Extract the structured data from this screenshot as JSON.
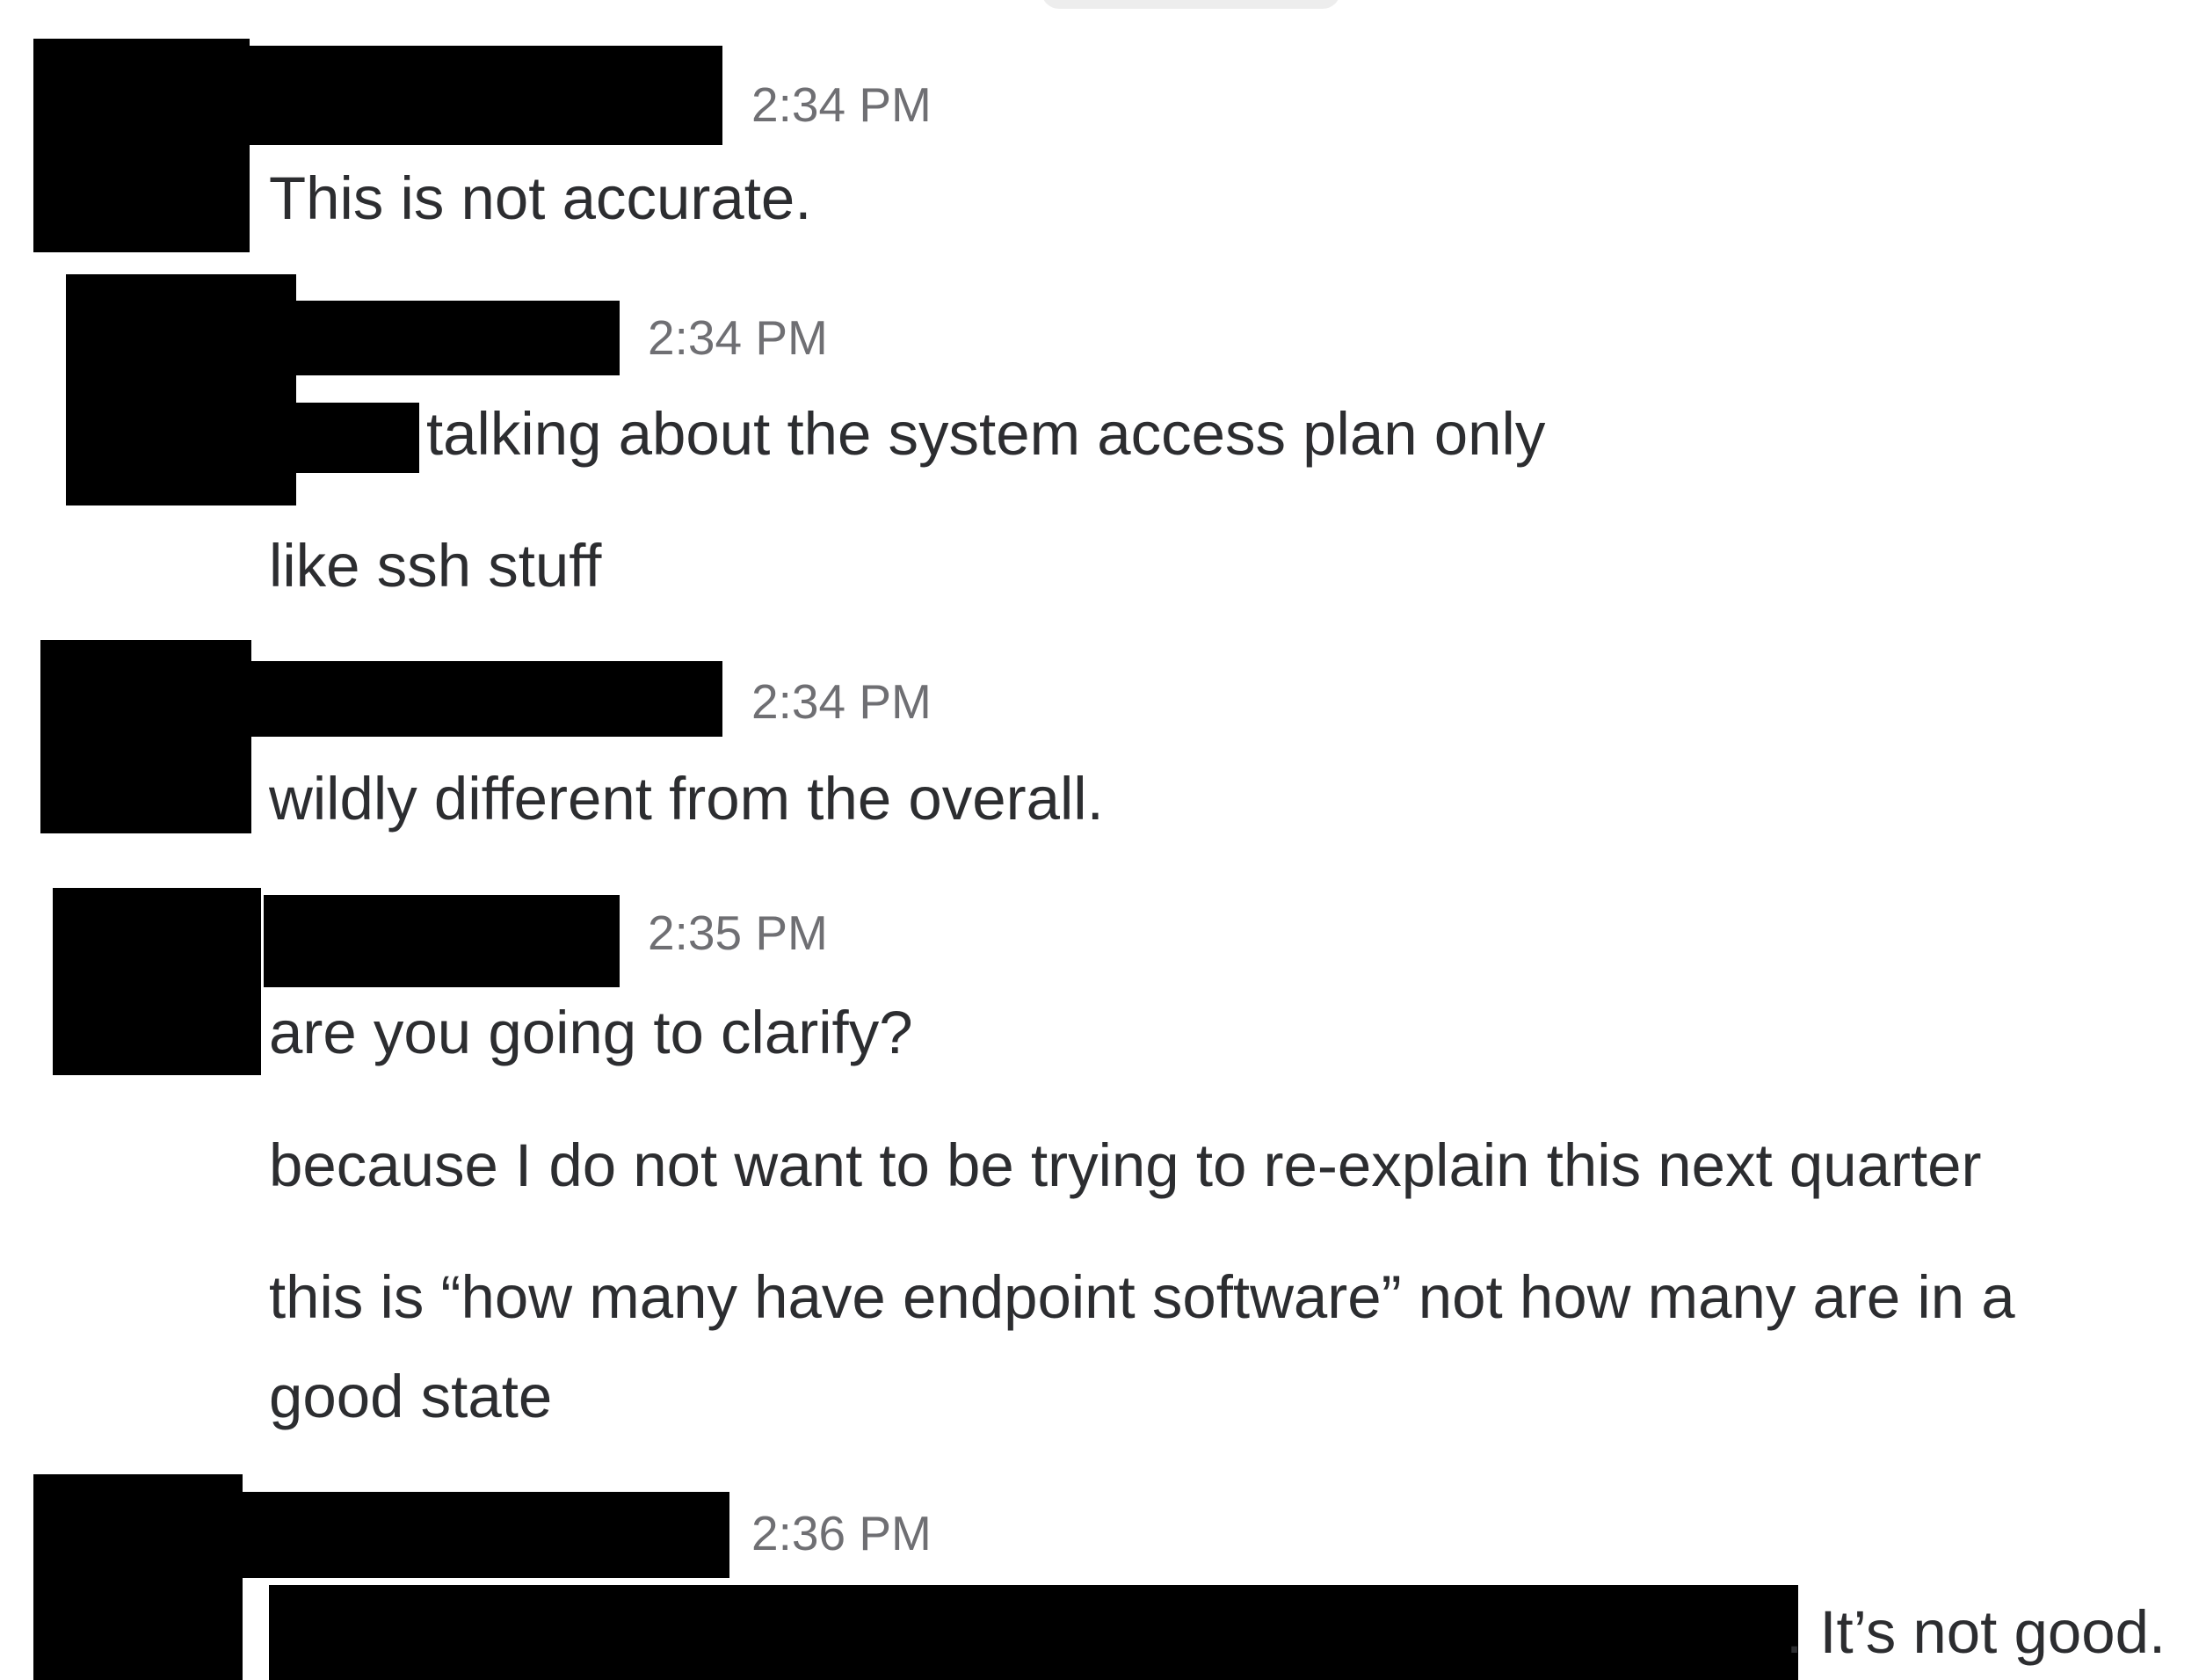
{
  "colors": {
    "background": "#ffffff",
    "message_text": "#2c2d30",
    "timestamp_text": "#6f6f73",
    "redaction": "#000000"
  },
  "messages": [
    {
      "timestamp": "2:34 PM",
      "lines": [
        "This is not accurate."
      ]
    },
    {
      "timestamp": "2:34 PM",
      "lines": [
        "talking about the system access plan only",
        "like ssh stuff"
      ]
    },
    {
      "timestamp": "2:34 PM",
      "lines": [
        "wildly different from the overall."
      ]
    },
    {
      "timestamp": "2:35 PM",
      "lines": [
        "are you going to clarify?",
        "because I do not want to be trying to re-explain this next quarter",
        "this is “how many have endpoint software” not how many are in a",
        "good state"
      ]
    },
    {
      "timestamp": "2:36 PM",
      "lines": [
        ". It’s not good."
      ]
    }
  ]
}
